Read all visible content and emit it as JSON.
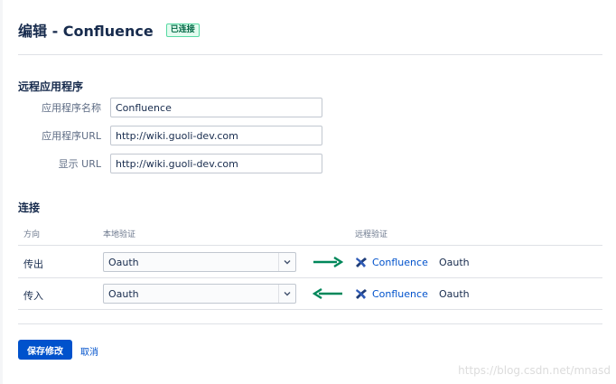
{
  "header": {
    "title": "编辑 - Confluence",
    "status_badge": "已连接"
  },
  "remote_app": {
    "section_title": "远程应用程序",
    "fields": [
      {
        "label": "应用程序名称",
        "value": "Confluence"
      },
      {
        "label": "应用程序URL",
        "value": "http://wiki.guoli-dev.com"
      },
      {
        "label": "显示 URL",
        "value": "http://wiki.guoli-dev.com"
      }
    ]
  },
  "connection": {
    "section_title": "连接",
    "headers": {
      "direction": "方向",
      "local_auth": "本地验证",
      "remote_auth": "远程验证"
    },
    "rows": [
      {
        "direction": "传出",
        "local_auth": "Oauth",
        "arrow": "right",
        "remote_app": "Confluence",
        "remote_auth": "Oauth"
      },
      {
        "direction": "传入",
        "local_auth": "Oauth",
        "arrow": "left",
        "remote_app": "Confluence",
        "remote_auth": "Oauth"
      }
    ]
  },
  "actions": {
    "save_label": "保存修改",
    "cancel_label": "取消"
  },
  "colors": {
    "primary": "#0052cc",
    "arrow_green": "#00875a",
    "badge_green": "#006644",
    "text": "#172b4d"
  },
  "watermark": "https://blog.csdn.net/mnasd"
}
